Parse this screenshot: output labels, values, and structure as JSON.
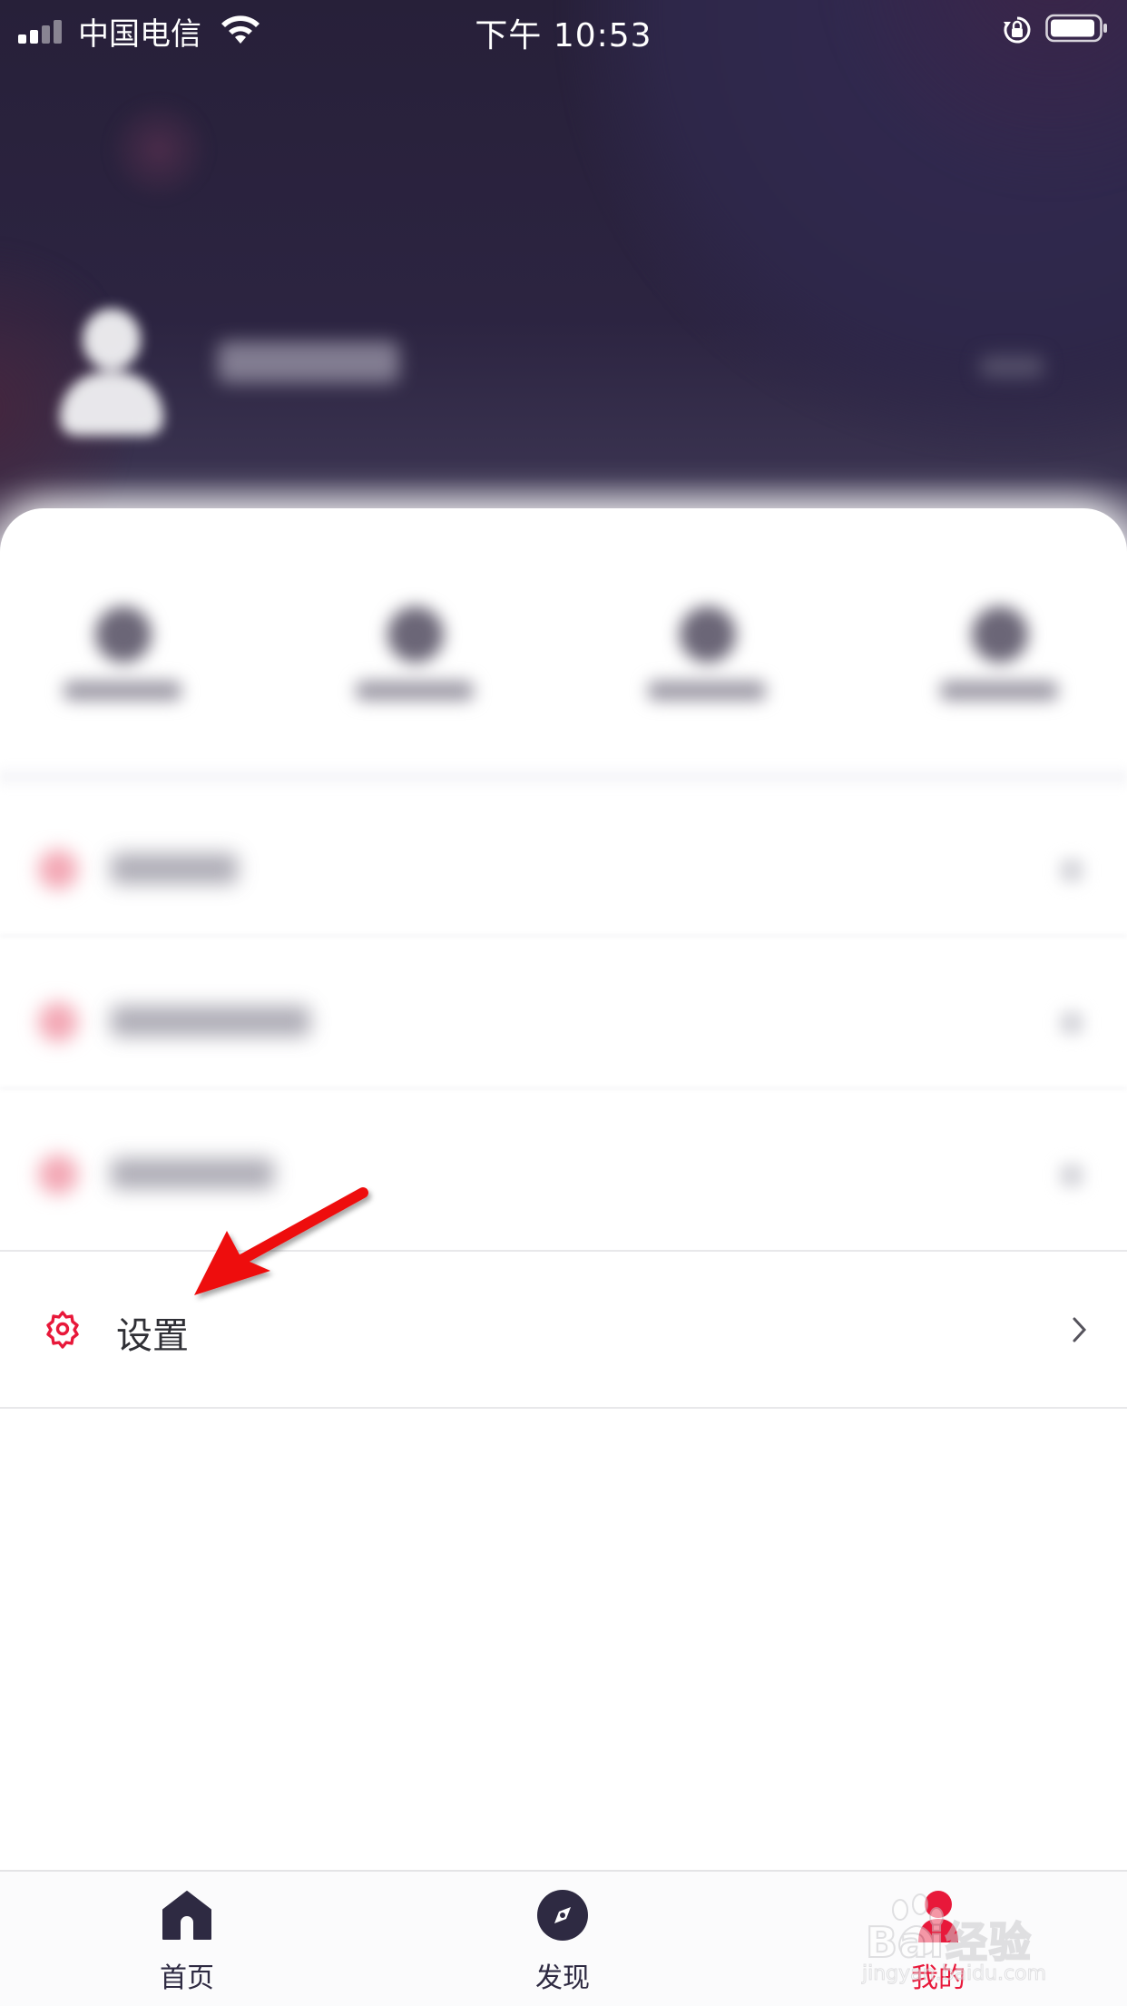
{
  "status_bar": {
    "carrier": "中国电信",
    "time": "下午 10:53"
  },
  "menu": {
    "settings_label": "设置"
  },
  "tabbar": {
    "items": [
      {
        "label": "首页",
        "icon": "home-icon"
      },
      {
        "label": "发现",
        "icon": "compass-icon"
      },
      {
        "label": "我的",
        "icon": "profile-icon",
        "active": true
      }
    ]
  },
  "watermark": {
    "logo": "Bai经验",
    "url": "jingyan.baidu.com"
  },
  "colors": {
    "header_bg": "#2a2340",
    "accent": "#e8183a",
    "tab_text": "#2e2a42"
  }
}
